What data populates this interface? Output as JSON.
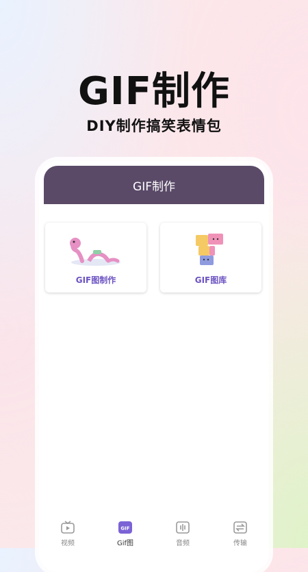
{
  "hero": {
    "title": "GIF制作",
    "subtitle": "DIY制作搞笑表情包"
  },
  "app": {
    "header_title": "GIF制作",
    "cards": [
      {
        "label": "GIF图制作",
        "icon": "dinosaur-illustration"
      },
      {
        "label": "GIF图库",
        "icon": "blocks-illustration"
      }
    ]
  },
  "tabs": [
    {
      "label": "视频",
      "icon": "tv-icon",
      "active": false
    },
    {
      "label": "Gif图",
      "icon": "gif-icon",
      "icon_text": "GIF",
      "active": true
    },
    {
      "label": "音频",
      "icon": "audio-icon",
      "active": false
    },
    {
      "label": "传输",
      "icon": "transfer-icon",
      "active": false
    }
  ],
  "colors": {
    "header_bg": "#5a4a68",
    "accent": "#6c53c2"
  }
}
